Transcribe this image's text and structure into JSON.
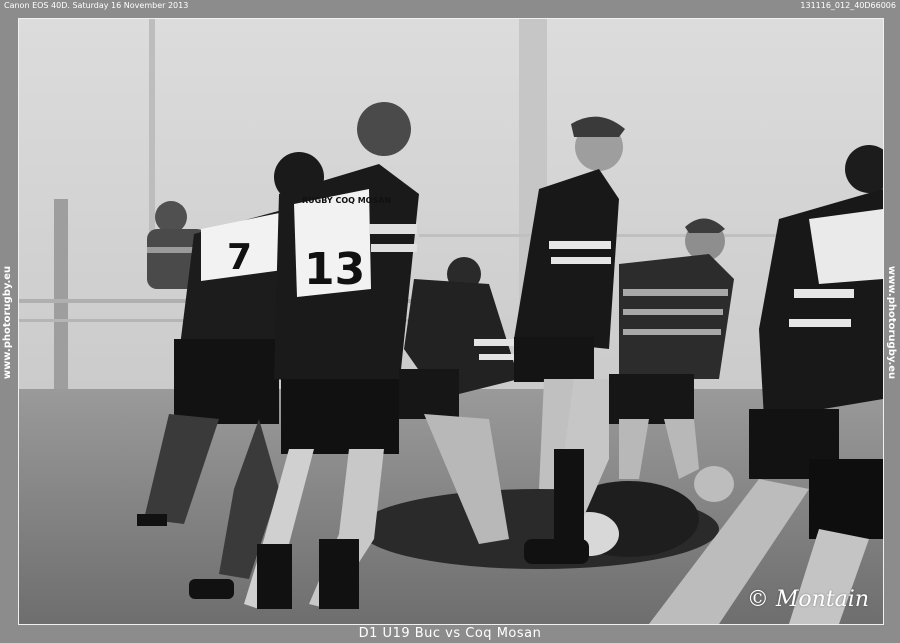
{
  "header": {
    "camera_info": "Canon EOS 40D. Saturday 16 November 2013",
    "image_code": "131116_012_40D66006"
  },
  "sidebar": {
    "left_url": "www.photorugby.eu",
    "right_url": "www.photorugby.eu"
  },
  "photo": {
    "jersey_numbers": [
      "7",
      "13"
    ],
    "jersey_text": "RUGBY COQ MOSAN",
    "credit": "© Montain"
  },
  "footer": {
    "caption": "D1 U19    Buc vs Coq Mosan"
  },
  "colors": {
    "frame": "#8c8c8c",
    "text": "#ffffff"
  }
}
